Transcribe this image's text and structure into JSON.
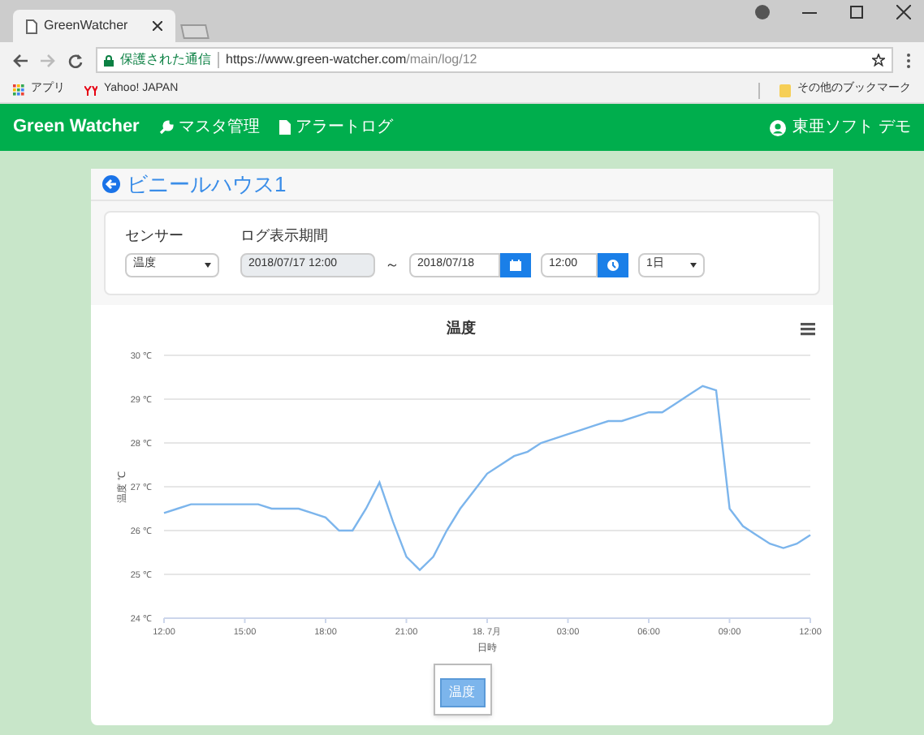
{
  "browser": {
    "tab_title": "GreenWatcher",
    "secure_label": "保護された通信",
    "url_host": "https://www.green-watcher.com",
    "url_path": "/main/log/12",
    "bookmarks": [
      {
        "label": "アプリ",
        "kind": "apps"
      },
      {
        "label": "Yahoo! JAPAN",
        "kind": "yahoo"
      }
    ],
    "other_bookmarks": "その他のブックマーク"
  },
  "navbar": {
    "brand": "Green Watcher",
    "links": [
      {
        "label": "マスタ管理",
        "kind": "wrench"
      },
      {
        "label": "アラートログ",
        "kind": "file"
      }
    ],
    "user": "東亜ソフト デモ"
  },
  "page": {
    "title": "ビニールハウス1"
  },
  "filters": {
    "sensor_label": "センサー",
    "sensor_value": "温度",
    "period_label": "ログ表示期間",
    "start": "2018/07/17 12:00",
    "separator": "～",
    "end_date": "2018/07/18",
    "end_time": "12:00",
    "span": "1日"
  },
  "chart": {
    "chart_data": {
      "type": "line",
      "title": "温度",
      "xlabel": "日時",
      "ylabel": "温度 ℃",
      "categories": [
        "12:00",
        null,
        null,
        null,
        null,
        null,
        "15:00",
        null,
        null,
        null,
        null,
        null,
        "18:00",
        null,
        null,
        null,
        null,
        null,
        "21:00",
        null,
        null,
        null,
        null,
        null,
        "18. 7月",
        null,
        null,
        null,
        null,
        null,
        "03:00",
        null,
        null,
        null,
        null,
        null,
        "06:00",
        null,
        null,
        null,
        null,
        null,
        "09:00",
        null,
        null,
        null,
        null,
        null,
        "12:00"
      ],
      "grid": true,
      "ylim": [
        24,
        30
      ],
      "yticks": [
        {
          "value": 24,
          "label": "24 ℃"
        },
        {
          "value": 25,
          "label": "25 ℃"
        },
        {
          "value": 26,
          "label": "26 ℃"
        },
        {
          "value": 27,
          "label": "27 ℃"
        },
        {
          "value": 28,
          "label": "28 ℃"
        },
        {
          "value": 29,
          "label": "29 ℃"
        },
        {
          "value": 30,
          "label": "30 ℃"
        }
      ],
      "series": [
        {
          "name": "温度",
          "color": "#7cb5ec",
          "values": [
            26.4,
            26.5,
            26.6,
            26.6,
            26.6,
            26.6,
            26.6,
            26.6,
            26.5,
            26.5,
            26.5,
            26.4,
            26.3,
            26.0,
            26.0,
            26.5,
            27.1,
            26.2,
            25.4,
            25.1,
            25.4,
            26.0,
            26.5,
            26.9,
            27.3,
            27.5,
            27.7,
            27.8,
            28.0,
            28.1,
            28.2,
            28.3,
            28.4,
            28.5,
            28.5,
            28.6,
            28.7,
            28.7,
            28.9,
            29.1,
            29.3,
            29.2,
            26.5,
            26.1,
            25.9,
            25.7,
            25.6,
            25.7,
            25.9
          ]
        }
      ]
    },
    "legend": [
      {
        "selected": true
      }
    ]
  }
}
